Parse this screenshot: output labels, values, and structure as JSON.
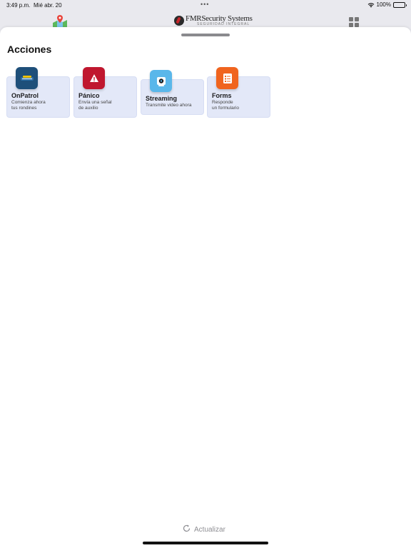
{
  "status_bar": {
    "time": "3:49 p.m.",
    "date": "Mié abr. 20",
    "dots": "•••",
    "battery": "100%"
  },
  "header": {
    "brand_name": "FMRSecurity Systems",
    "brand_tagline": "SEGURIDAD INTEGRAL"
  },
  "sheet": {
    "title": "Acciones",
    "actions": [
      {
        "title": "OnPatrol",
        "desc_line1": "Comienza ahora",
        "desc_line2": "tus rondines",
        "color": "#1e4f7a"
      },
      {
        "title": "Pánico",
        "desc_line1": "Envía una señal",
        "desc_line2": "de auxilio",
        "color": "#c0172f"
      },
      {
        "title": "Streaming",
        "desc_line1": "Transmite video ahora",
        "desc_line2": "",
        "color": "#5ab7ea"
      },
      {
        "title": "Forms",
        "desc_line1": "Responde",
        "desc_line2": "un formulario",
        "color": "#f0641e"
      }
    ],
    "refresh_label": "Actualizar"
  },
  "colors": {
    "card_bg": "#e3e8f8",
    "refresh": "#8e8e93"
  }
}
